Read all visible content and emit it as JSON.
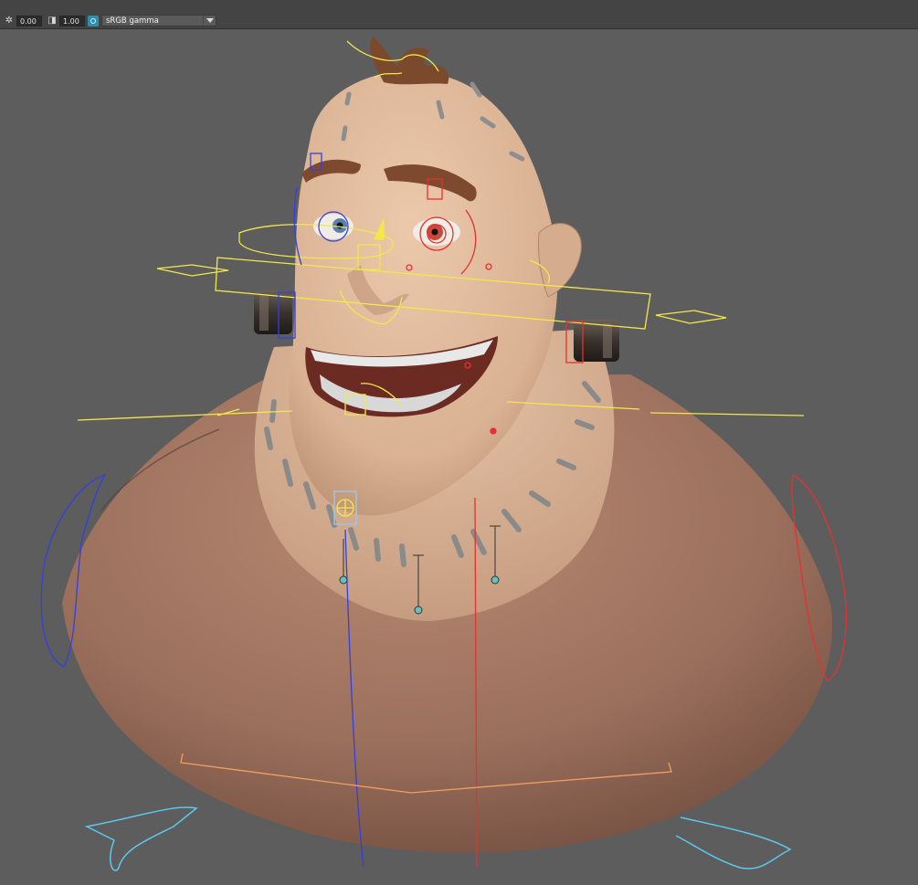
{
  "toolbar": {
    "exposure_icon": "exposure-icon",
    "exposure_value": "0.00",
    "gamma_icon": "gamma-icon",
    "gamma_value": "1.00",
    "color_space_icon": "color-management-icon",
    "color_space": "sRGB gamma",
    "dropdown_icon": "chevron-down-icon"
  },
  "colors": {
    "viewport_bg": "#5d5d5d",
    "ui_bar": "#444444",
    "skin": "#ddb596",
    "body": "#9e7360",
    "hair": "#7a4a2e",
    "ctrl_yellow": "#f2e84a",
    "ctrl_red": "#e83030",
    "ctrl_blue": "#3240e0",
    "ctrl_cyan": "#58c8e8"
  }
}
